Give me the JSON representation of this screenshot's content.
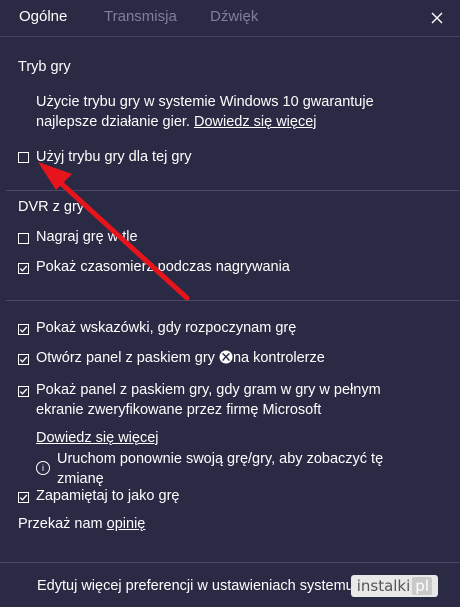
{
  "tabs": [
    "Ogólne",
    "Transmisja",
    "Dźwięk"
  ],
  "game_mode": {
    "heading": "Tryb gry",
    "desc_line1": "Użycie trybu gry w systemie Windows 10 gwarantuje",
    "desc_line2_prefix": "najlepsze działanie gier.",
    "learn_more": "Dowiedz się więcej",
    "checkbox": {
      "label": "Użyj trybu gry dla tej gry",
      "checked": false
    }
  },
  "dvr": {
    "heading": "DVR z gry",
    "items": [
      {
        "label": "Nagraj grę w tle",
        "checked": false
      },
      {
        "label": "Pokaż czasomierz podczas nagrywania",
        "checked": true
      }
    ]
  },
  "options": {
    "tips": {
      "label": "Pokaż wskazówki, gdy rozpoczynam grę",
      "checked": true
    },
    "open_bar": {
      "label_prefix": "Otwórz panel z paskiem gry",
      "label_suffix": "na kontrolerze",
      "checked": true
    },
    "fullscreen": {
      "line1": "Pokaż panel z paskiem gry, gdy gram w gry w pełnym",
      "line2": "ekranie zweryfikowane przez firmę Microsoft",
      "checked": true
    },
    "learn_more": "Dowiedz się więcej",
    "info_line1": "Uruchom ponownie swoją grę/gry, aby zobaczyć tę",
    "info_line2": "zmianę",
    "remember": {
      "label": "Zapamiętaj to jako grę",
      "checked": true
    },
    "feedback_prefix": "Przekaż nam",
    "feedback_link": "opinię"
  },
  "footer": {
    "label": "Edytuj więcej preferencji w ustawieniach systemu Windows"
  },
  "watermark": {
    "text": "instalki",
    "suffix": "pl"
  },
  "colors": {
    "background": "#2a2a44",
    "arrow": "#e8141c",
    "text": "#ffffff",
    "inactive_tab": "#7f7f99"
  }
}
